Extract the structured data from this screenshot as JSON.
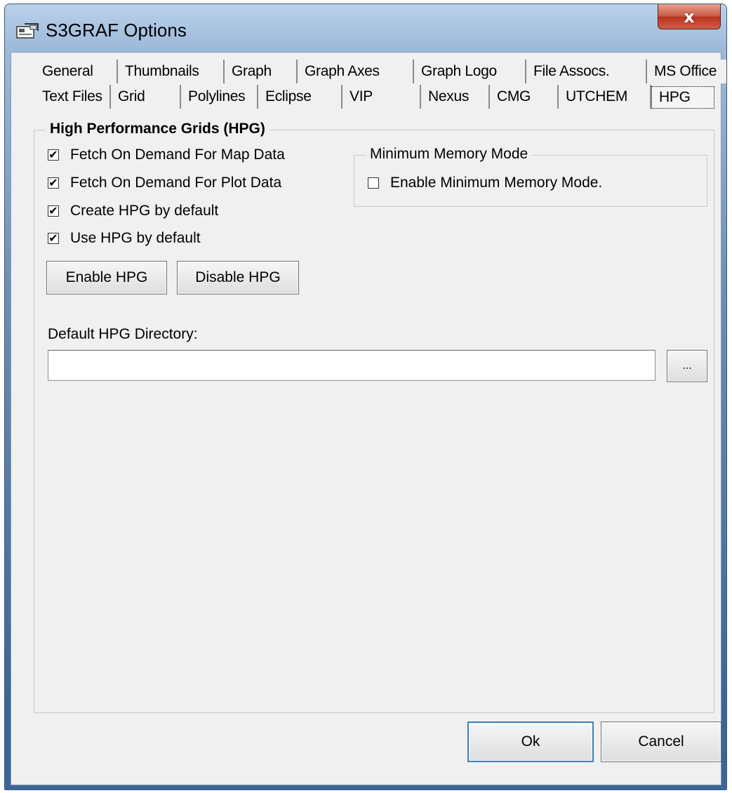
{
  "window": {
    "title": "S3GRAF Options",
    "close_label": "x"
  },
  "tabs": {
    "row1": [
      "General",
      "Thumbnails",
      "Graph",
      "Graph Axes",
      "Graph Logo",
      "File Assocs.",
      "MS Office"
    ],
    "row2": [
      "Text Files",
      "Grid",
      "Polylines",
      "Eclipse",
      "VIP",
      "Nexus",
      "CMG",
      "UTCHEM",
      "HPG"
    ],
    "active": "HPG"
  },
  "hpg_group": {
    "title": "High Performance Grids (HPG)",
    "checkboxes": [
      {
        "label": "Fetch On Demand For Map Data",
        "checked": true
      },
      {
        "label": "Fetch On Demand For Plot Data",
        "checked": true
      },
      {
        "label": "Create HPG by default",
        "checked": true
      },
      {
        "label": "Use HPG by default",
        "checked": true
      }
    ],
    "enable_button": "Enable HPG",
    "disable_button": "Disable HPG",
    "directory_label": "Default HPG Directory:",
    "directory_value": "",
    "browse_button": "..."
  },
  "memory_group": {
    "title": "Minimum Memory Mode",
    "checkbox_label": "Enable Minimum Memory Mode.",
    "checked": false
  },
  "footer": {
    "ok_label": "Ok",
    "cancel_label": "Cancel"
  }
}
